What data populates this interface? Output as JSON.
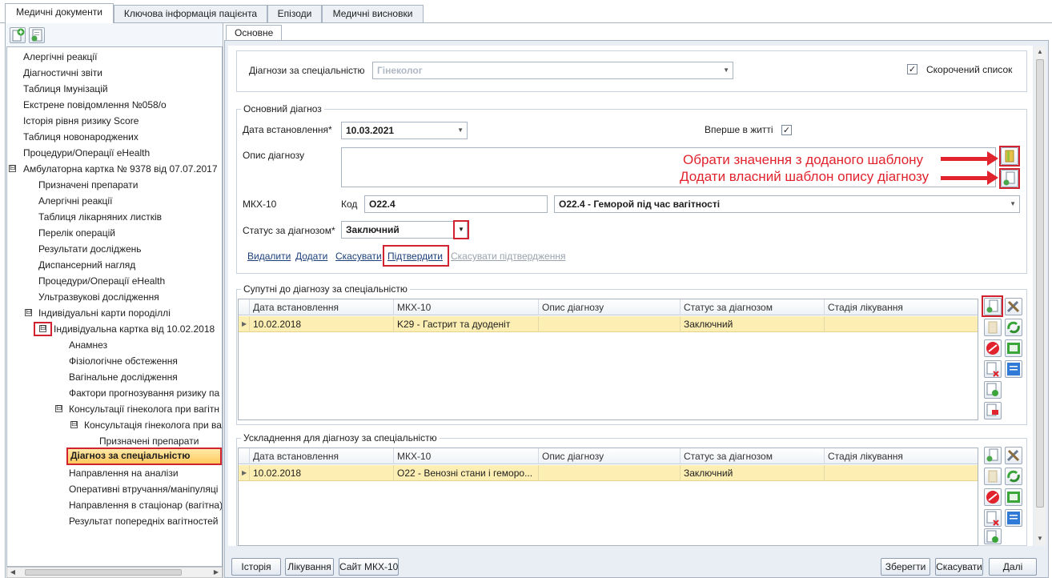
{
  "top_tabs": [
    "Медичні документи",
    "Ключова інформація пацієнта",
    "Епізоди",
    "Медичні висновки"
  ],
  "toolbar": {
    "add_icon": "add-document-icon",
    "edit_icon": "edit-document-icon"
  },
  "tree": {
    "items": [
      {
        "label": "Алергічні реакції"
      },
      {
        "label": "Діагностичні звіти"
      },
      {
        "label": "Таблиця Імунізацій"
      },
      {
        "label": "Екстрене повідомлення №058/о"
      },
      {
        "label": "Історія рівня ризику Score"
      },
      {
        "label": "Таблиця новонароджених"
      },
      {
        "label": "Процедури/Операції eHealth"
      },
      {
        "label": "Амбулаторна картка № 9378 від 07.07.2017",
        "expander": "⊟"
      },
      {
        "label": "Призначені препарати"
      },
      {
        "label": "Алергічні реакції"
      },
      {
        "label": "Таблиця лікарняних листків"
      },
      {
        "label": "Перелік операцій"
      },
      {
        "label": "Результати досліджень"
      },
      {
        "label": "Диспансерний нагляд"
      },
      {
        "label": "Процедури/Операції eHealth"
      },
      {
        "label": "Ультразвукові дослідження"
      },
      {
        "label": "Індивідуальні карти породіллі",
        "expander": "⊟"
      },
      {
        "label": "Індивідуальна картка від 10.02.2018",
        "expander": "⊟"
      },
      {
        "label": "Анамнез"
      },
      {
        "label": "Фізіологічне обстеження"
      },
      {
        "label": "Вагінальне дослідження"
      },
      {
        "label": "Фактори прогнозування ризику па"
      },
      {
        "label": "Консультації гінеколога при вагітн",
        "expander": "⊟"
      },
      {
        "label": "Консультація гінеколога при ва",
        "expander": "⊟"
      },
      {
        "label": "Призначені препарати"
      },
      {
        "label": "Діагноз за спеціальністю"
      },
      {
        "label": "Направлення на аналізи"
      },
      {
        "label": "Оперативні втручання/маніпуляці"
      },
      {
        "label": "Направлення в стаціонар (вагітна)"
      },
      {
        "label": "Результат попередніх вагітностей"
      }
    ]
  },
  "inner_tab": "Основне",
  "specialty": {
    "label": "Діагнози за спеціальністю",
    "value": "Гінеколог",
    "short_list_label": "Скорочений список",
    "short_list_checked": "✓"
  },
  "main_diagnosis": {
    "group_title": "Основний діагноз",
    "date_label": "Дата встановлення*",
    "date_value": "10.03.2021",
    "first_time_label": "Вперше в житті",
    "first_time_checked": "✓",
    "description_label": "Опис діагнозу",
    "description_value": "",
    "mkx_label": "МКХ-10",
    "code_label": "Код",
    "code_value": "O22.4",
    "mkx_value": "O22.4 - Геморой під час вагітності",
    "status_label": "Статус за діагнозом*",
    "status_value": "Заключний",
    "actions": {
      "delete": "Видалити",
      "add": "Додати",
      "cancel": "Скасувати",
      "confirm": "Підтвердити",
      "cancel_confirm": "Скасувати підтвердження"
    }
  },
  "annotations": {
    "select_template": "Обрати значення з доданого шаблону",
    "add_template": "Додати власний шаблон опису діагнозу"
  },
  "concomitant": {
    "group_title": "Супутні до діагнозу за спеціальністю",
    "columns": [
      "Дата встановлення",
      "МКХ-10",
      "Опис діагнозу",
      "Статус за діагнозом",
      "Стадія лікування"
    ],
    "rows": [
      {
        "date": "10.02.2018",
        "mkx": "K29 - Гастрит та дуоденіт",
        "description": "",
        "status": "Заключний",
        "stage": ""
      }
    ]
  },
  "complications": {
    "group_title": "Ускладнення для діагнозу за спеціальністю",
    "columns": [
      "Дата встановлення",
      "МКХ-10",
      "Опис діагнозу",
      "Статус за діагнозом",
      "Стадія лікування"
    ],
    "rows": [
      {
        "date": "10.02.2018",
        "mkx": "O22 - Венозні стани і геморо...",
        "description": "",
        "status": "Заключний",
        "stage": ""
      }
    ]
  },
  "bottom_buttons": {
    "history": "Історія",
    "treatment": "Лікування",
    "mkx_site": "Сайт МКХ-10",
    "save": "Зберегти",
    "cancel": "Скасувати",
    "next": "Далі"
  },
  "colors": {
    "selected_row": "#fdeeb3",
    "highlight_red": "#e0232d",
    "link_blue": "#1b3f7a"
  }
}
